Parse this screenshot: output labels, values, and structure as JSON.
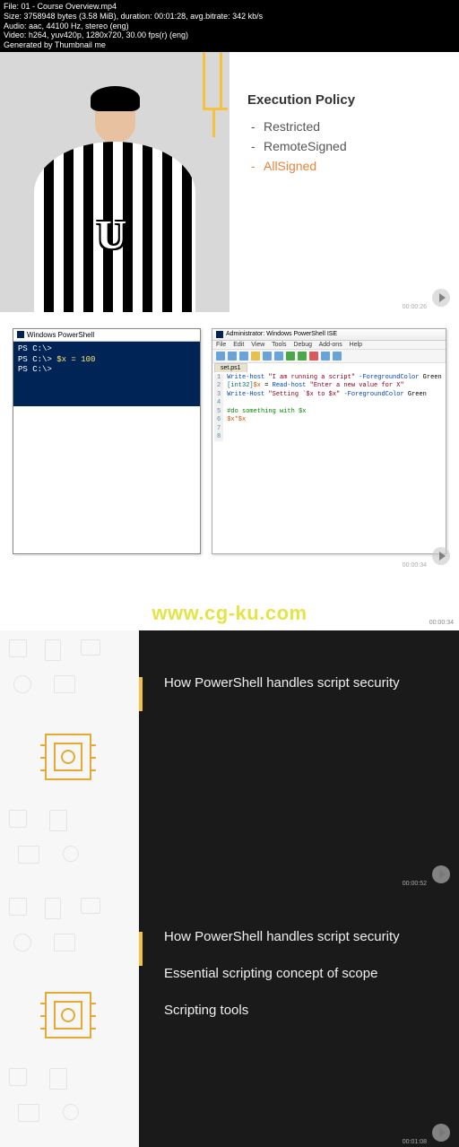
{
  "metadata": {
    "file": "File: 01 - Course Overview.mp4",
    "size": "Size: 3758948 bytes (3.58 MiB), duration: 00:01:28, avg.bitrate: 342 kb/s",
    "audio": "Audio: aac, 44100 Hz, stereo (eng)",
    "video": "Video: h264, yuv420p, 1280x720, 30.00 fps(r) (eng)",
    "generated": "Generated by Thumbnail me"
  },
  "slide1": {
    "letter": "U",
    "title": "Execution Policy",
    "items": [
      "Restricted",
      "RemoteSigned",
      "AllSigned"
    ],
    "timestamp": "00:00:26"
  },
  "slide2": {
    "ps_title": "Windows PowerShell",
    "ps_lines": {
      "l1a": "PS C:\\>",
      "l2a": "PS C:\\> ",
      "l2b": "$x = 100",
      "l3a": "PS C:\\>"
    },
    "ise_title": "Administrator: Windows PowerShell ISE",
    "ise_menu": [
      "File",
      "Edit",
      "View",
      "Tools",
      "Debug",
      "Add-ons",
      "Help"
    ],
    "ise_tab": "set.ps1",
    "ise_gutter": [
      "1",
      "2",
      "3",
      "4",
      "5",
      "6",
      "7",
      "8"
    ],
    "code": {
      "l1_cmd": "Write-host ",
      "l1_str": "\"I am running a script\"",
      "l1_param": " -ForegroundColor ",
      "l1_val": "Green",
      "l2_type": "[int32]",
      "l2_var": "$x",
      "l2_eq": " = ",
      "l2_cmd": "Read-host ",
      "l2_str": "\"Enter a new value for X\"",
      "l3_cmd": "Write-Host ",
      "l3_str": "\"Setting `$x to $x\"",
      "l3_param": " -ForegroundColor ",
      "l3_val": "Green",
      "l5_comment": "#do something with $x",
      "l6_expr": "$x*$x"
    },
    "timestamp": "00:00:34"
  },
  "watermark": "www.cg-ku.com",
  "slide3": {
    "topic1": "How PowerShell handles script security",
    "timestamp_top": "00:00:34",
    "timestamp": "00:00:52"
  },
  "slide4": {
    "topic1": "How PowerShell handles script security",
    "topic2": "Essential scripting concept of scope",
    "topic3": "Scripting tools",
    "timestamp": "00:01:08"
  }
}
